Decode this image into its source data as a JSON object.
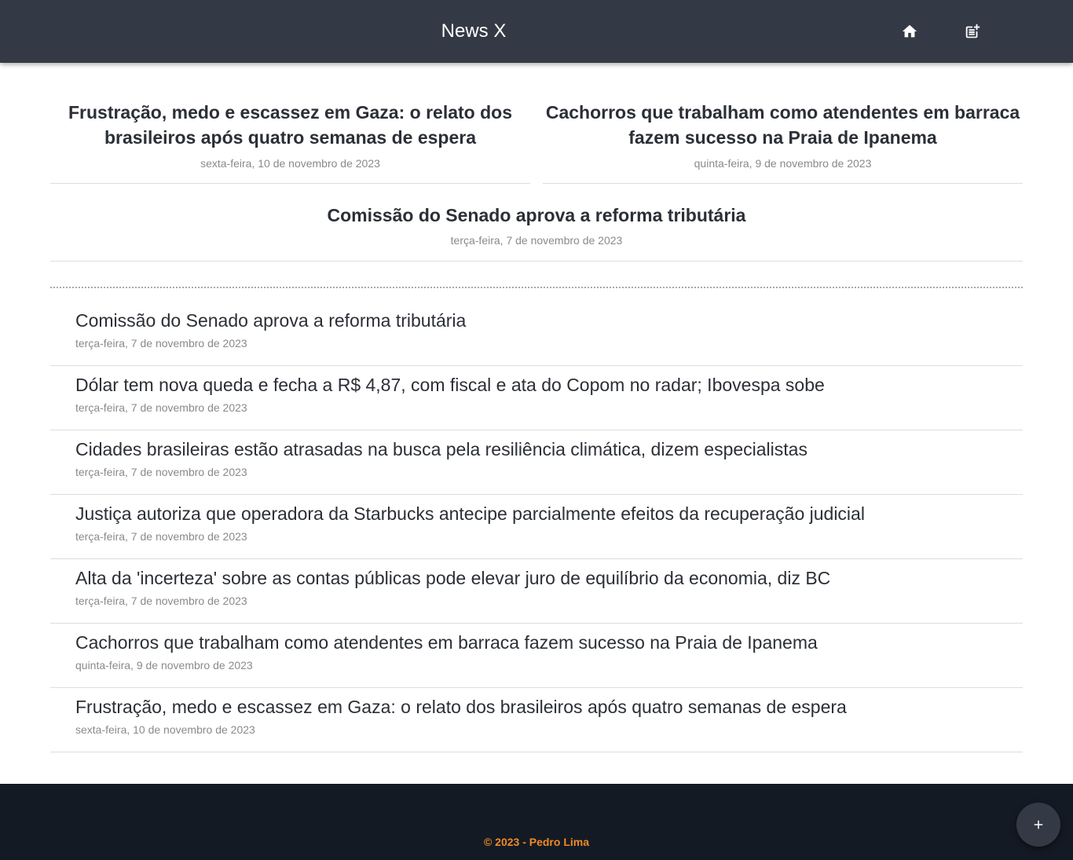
{
  "header": {
    "title": "News X",
    "icons": {
      "home": "home-icon",
      "new_post": "post-add-icon"
    }
  },
  "featured": [
    {
      "title": "Frustração, medo e escassez em Gaza: o relato dos brasileiros após quatro semanas de espera",
      "date": "sexta-feira, 10 de novembro de 2023"
    },
    {
      "title": "Cachorros que trabalham como atendentes em barraca fazem sucesso na Praia de Ipanema",
      "date": "quinta-feira, 9 de novembro de 2023"
    },
    {
      "title": "Comissão do Senado aprova a reforma tributária",
      "date": "terça-feira, 7 de novembro de 2023"
    }
  ],
  "news": [
    {
      "title": "Comissão do Senado aprova a reforma tributária",
      "date": "terça-feira, 7 de novembro de 2023"
    },
    {
      "title": "Dólar tem nova queda e fecha a R$ 4,87, com fiscal e ata do Copom no radar; Ibovespa sobe",
      "date": "terça-feira, 7 de novembro de 2023"
    },
    {
      "title": "Cidades brasileiras estão atrasadas na busca pela resiliência climática, dizem especialistas",
      "date": "terça-feira, 7 de novembro de 2023"
    },
    {
      "title": "Justiça autoriza que operadora da Starbucks antecipe parcialmente efeitos da recuperação judicial",
      "date": "terça-feira, 7 de novembro de 2023"
    },
    {
      "title": "Alta da 'incerteza' sobre as contas públicas pode elevar juro de equilíbrio da economia, diz BC",
      "date": "terça-feira, 7 de novembro de 2023"
    },
    {
      "title": "Cachorros que trabalham como atendentes em barraca fazem sucesso na Praia de Ipanema",
      "date": "quinta-feira, 9 de novembro de 2023"
    },
    {
      "title": "Frustração, medo e escassez em Gaza: o relato dos brasileiros após quatro semanas de espera",
      "date": "sexta-feira, 10 de novembro de 2023"
    }
  ],
  "footer": {
    "text": "© 2023 - Pedro Lima"
  },
  "fab": {
    "icon": "plus-icon"
  },
  "colors": {
    "header_bg": "#343a45",
    "footer_bg": "#141a24",
    "footer_text": "#f08a24"
  }
}
